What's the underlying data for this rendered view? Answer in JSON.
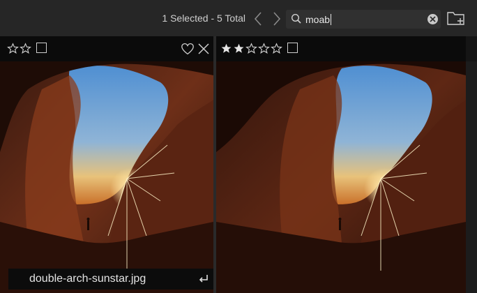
{
  "toolbar": {
    "selection_summary": "1 Selected - 5 Total",
    "prev_icon": "chevron-left-icon",
    "next_icon": "chevron-right-icon",
    "search": {
      "value": "moab",
      "icon": "search-icon",
      "clear_icon": "clear-circle-icon"
    },
    "new_folder_icon": "new-folder-icon"
  },
  "thumbnails": [
    {
      "rating": 0,
      "max_rating": 5,
      "visible_star_count": 2,
      "favorite_icon": "heart-outline-icon",
      "reject_icon": "close-icon",
      "filename": "double-arch-sunstar.jpg",
      "rename_icon": "enter-return-icon"
    },
    {
      "rating": 2,
      "max_rating": 5,
      "visible_star_count": 5
    }
  ],
  "colors": {
    "toolbar_bg": "#262626",
    "text": "#cfcfcf",
    "sky": "#5f9bd4",
    "rock": "#6a2c18"
  }
}
